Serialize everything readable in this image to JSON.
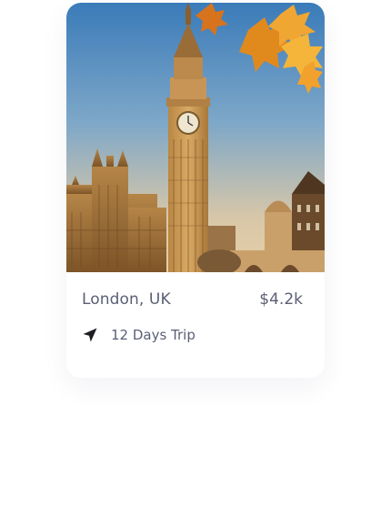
{
  "card": {
    "destination": "London, UK",
    "price": "$4.2k",
    "trip_length": "12 Days Trip",
    "trip_icon": "navigation-arrow-icon",
    "image_subject": "big-ben-photo"
  },
  "colors": {
    "text": "#5b5f75",
    "sky_top": "#3f7fbd",
    "sky_bottom": "#d9c6a6",
    "stone": "#c99a5a"
  }
}
